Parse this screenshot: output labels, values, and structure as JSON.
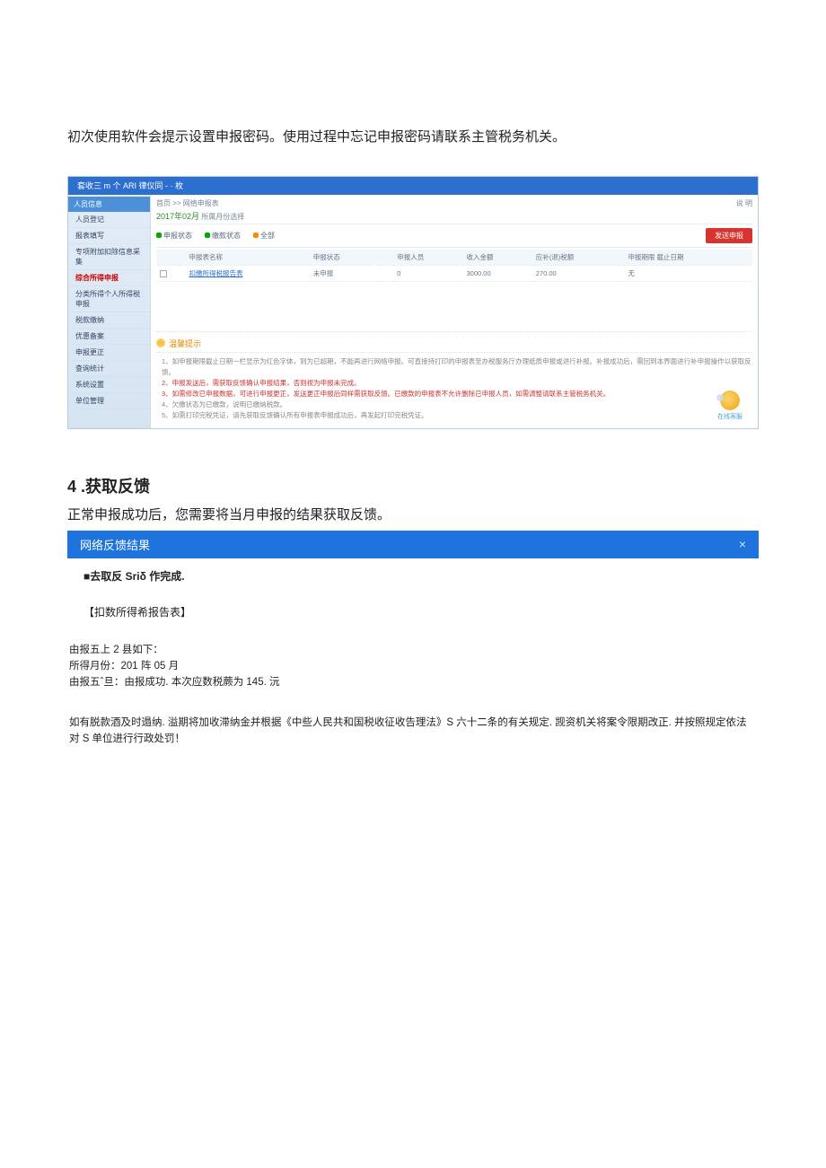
{
  "intro": "初次使用软件会提示设置申报密码。使用过程中忘记申报密码请联系主管税务机关。",
  "app": {
    "header_title": "套收三 m 个 ARI 律仪同 - · 枚",
    "header_right": "",
    "sidebar_top": "人员信息",
    "sidebar": {
      "items": [
        "人员登记",
        "报表填写",
        "专项附加扣除信息采集",
        "综合所得申报",
        "分类所得个人所得税申报",
        "税款缴纳",
        "优惠备案",
        "申报更正",
        "查询统计",
        "系统设置",
        "单位管理"
      ]
    },
    "breadcrumb": "首页 >> 网络申报表",
    "top_right": "说 明",
    "period_value": "2017年02月",
    "period_suffix": "所属月份选择",
    "filter": {
      "f1_label": "申报状态",
      "f1_value": "",
      "f2_label": "缴款状态",
      "f2_value": "",
      "all": "全部"
    },
    "red_button": "发送申报",
    "table": {
      "headers": [
        "",
        "申报表名称",
        "申报状态",
        "",
        "申报人员",
        "收入金额",
        "应补(退)税额",
        "申报期限 截止日期"
      ],
      "row": {
        "name": "扣缴所得税报告表",
        "status": "未申报",
        "col_a": "0",
        "income": "3000.00",
        "tax": "270.00",
        "deadline": "无"
      }
    },
    "hint": {
      "title": "温馨提示",
      "items": [
        "1、如申报期限截止日期一栏显示为红色字体，则为已超期，不能再进行网络申报。可直接持打印的申报表至办税服务厅办理纸质申报或进行补报。补报成功后，需回到本界面进行补申报操作以获取反馈。",
        "2、申报发送后，需获取反馈确认申报结果，否则视为申报未完成。",
        "3、如需修改已申报数据，可进行申报更正，发送更正申报后同样需获取反馈。已缴款的申报表不允许删除已申报人员，如需调整请联系主管税务机关。",
        "4、欠缴状态为已缴款，说明已缴纳税款。",
        "5、如需打印完税凭证，请先获取反馈确认所有申报表申报成功后，再发起打印完税凭证。"
      ]
    },
    "mascot_label": "在线客服"
  },
  "section4": {
    "heading": "4  .获取反馈",
    "desc": "正常申报成功后，您需要将当月申报的结果获取反馈。",
    "bar_title": "网络反馈结果",
    "body_line1": "■去取反 Sriδ 作完成.",
    "body_line2": "【扣数所得希报告表】",
    "detail_line1": "由报五上 2 县如下：",
    "detail_line2": "所得月份：201 阵 05 月",
    "detail_line3": "由报五ˆ旦：由报成功. 本次应数税蕨为 145. 沅",
    "note": "如有脱款酒及时遢纳. 溢期将加收滞纳金并根据《中些人民共和国税收征收告理法》S 六十二条的有关规定. 觊资机关将案令限期改正. 并按照规定依法对 S 单位进行行政处罚！"
  }
}
